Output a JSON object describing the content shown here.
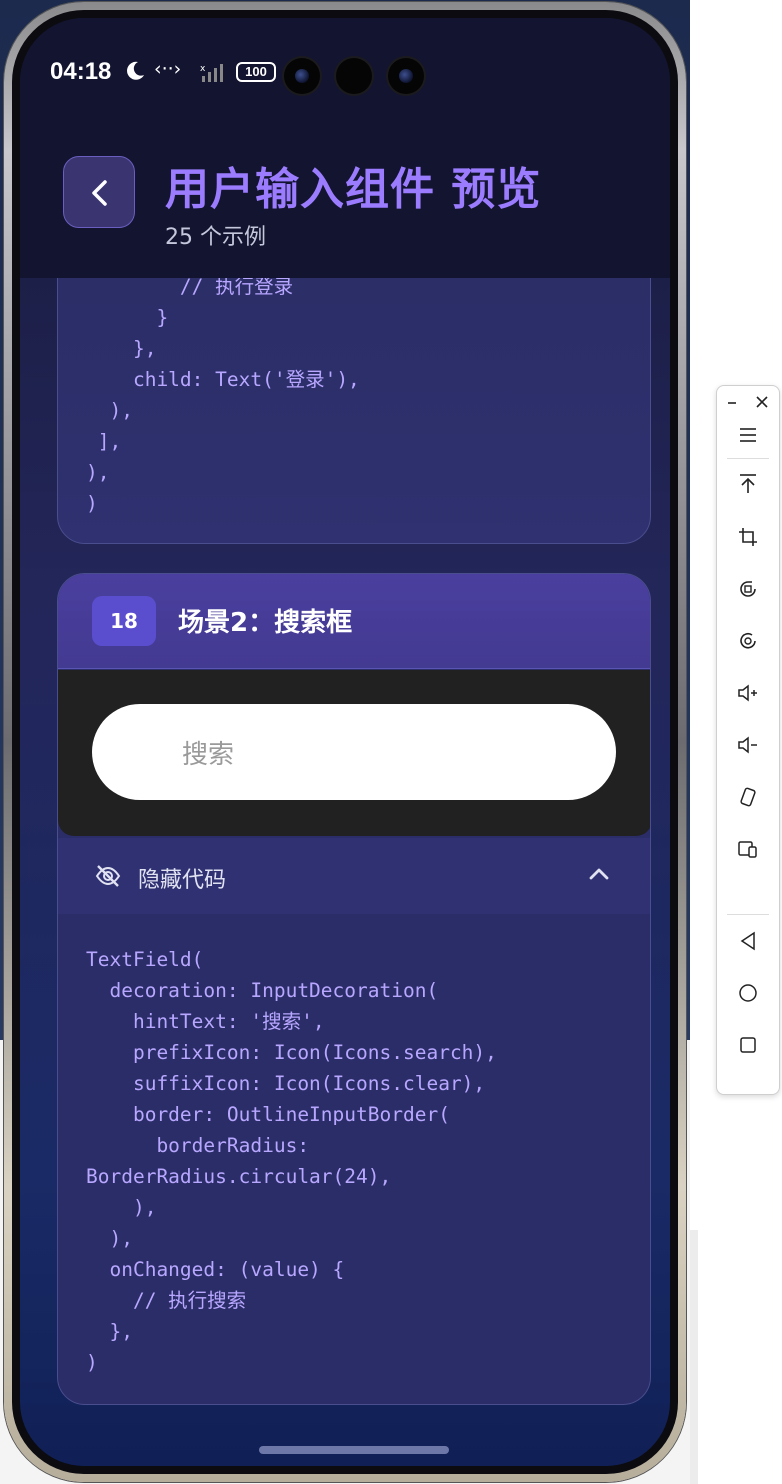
{
  "status_bar": {
    "time": "04:18",
    "code_glyph": "‹··›",
    "battery": "100"
  },
  "header": {
    "title": "用户输入组件 预览",
    "subtitle": "25 个示例"
  },
  "card1": {
    "code": "        // 执行登录\n      }\n    },\n    child: Text('登录'),\n  ),\n ],\n),\n)"
  },
  "card2": {
    "index": "18",
    "title": "场景2：搜索框",
    "search_hint": "搜索",
    "toggle_label": "隐藏代码",
    "code": "TextField(\n  decoration: InputDecoration(\n    hintText: '搜索',\n    prefixIcon: Icon(Icons.search),\n    suffixIcon: Icon(Icons.clear),\n    border: OutlineInputBorder(\n      borderRadius:\nBorderRadius.circular(24),\n    ),\n  ),\n  onChanged: (value) {\n    // 执行搜索\n  },\n)"
  },
  "colors": {
    "accent": "#9b7cff",
    "header_bg": "#131430",
    "card_head": "#4a3f9e",
    "badge": "#5a4ecf",
    "code_text": "#b8a7ff"
  },
  "tool_panel": {
    "icons": [
      "minimize-icon",
      "close-icon",
      "menu-icon",
      "scroll-top-icon",
      "crop-icon",
      "rotate-icon",
      "screen-record-icon",
      "volume-up-icon",
      "volume-down-icon",
      "rotate-device-icon",
      "screen-mirror-icon",
      "back-icon",
      "home-icon",
      "recents-icon"
    ]
  }
}
